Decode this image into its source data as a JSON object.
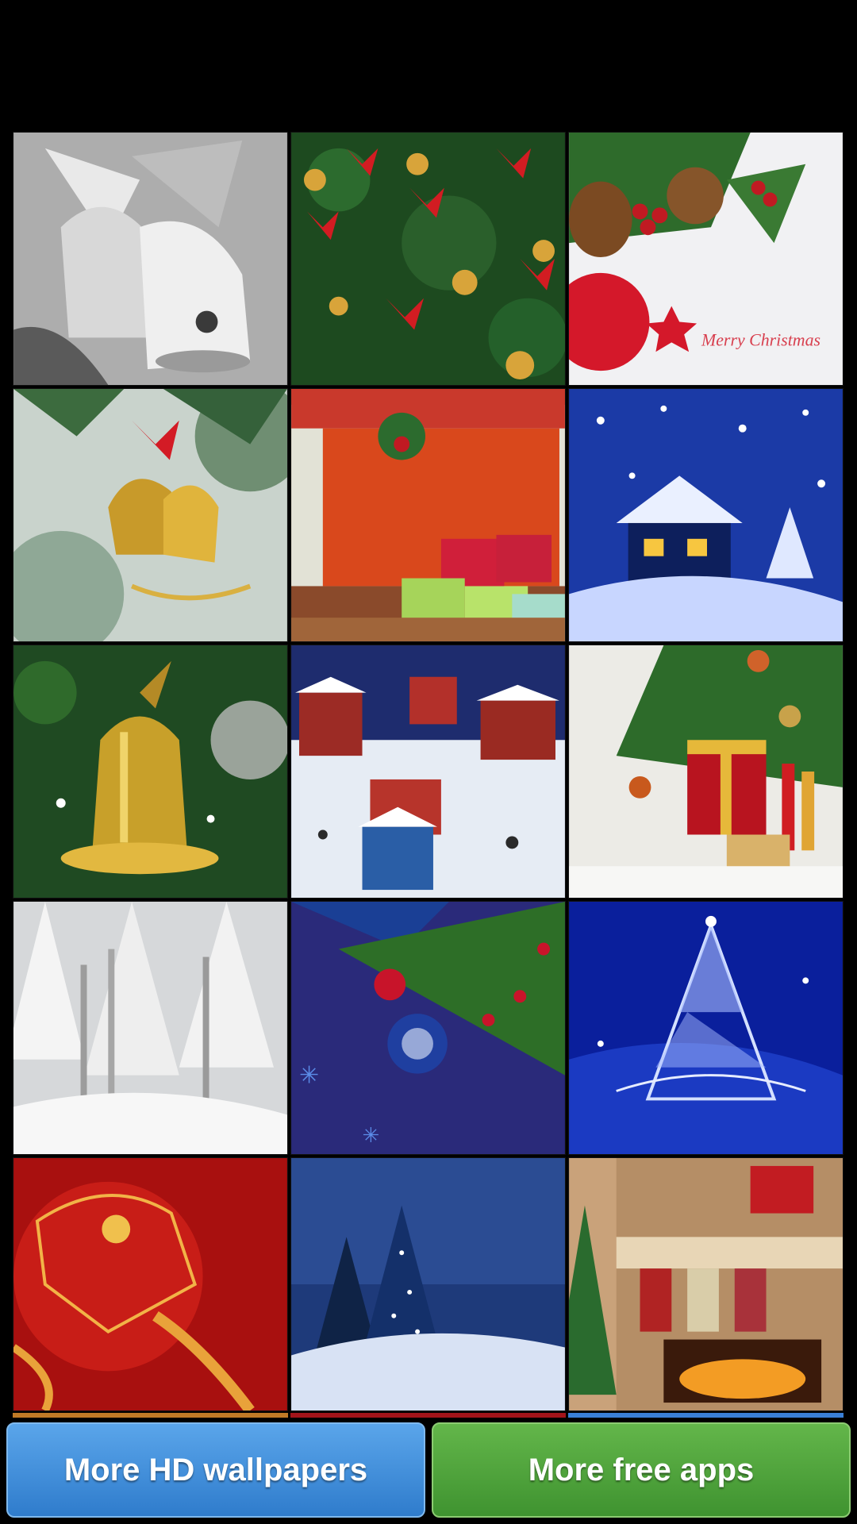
{
  "wallpapers": [
    {
      "name": "Silver bells"
    },
    {
      "name": "Tree with red bows"
    },
    {
      "name": "Pine cones and ornament",
      "caption": "Merry Christmas"
    },
    {
      "name": "Gold bells with red bow"
    },
    {
      "name": "Wrapped gifts"
    },
    {
      "name": "Snowy blue house"
    },
    {
      "name": "Gold bell on tree"
    },
    {
      "name": "Winter village"
    },
    {
      "name": "Tree with gifts"
    },
    {
      "name": "Snowy forest"
    },
    {
      "name": "Blue ornament on branch"
    },
    {
      "name": "Crystal tree on blue"
    },
    {
      "name": "Red ornament"
    },
    {
      "name": "Snowy night trees"
    },
    {
      "name": "Fireplace with stockings"
    }
  ],
  "buttons": {
    "more_wallpapers": "More HD wallpapers",
    "more_apps": "More free apps"
  },
  "colors": {
    "blue_button": "#3b8ad8",
    "green_button": "#4ea53a",
    "background": "#000000"
  }
}
